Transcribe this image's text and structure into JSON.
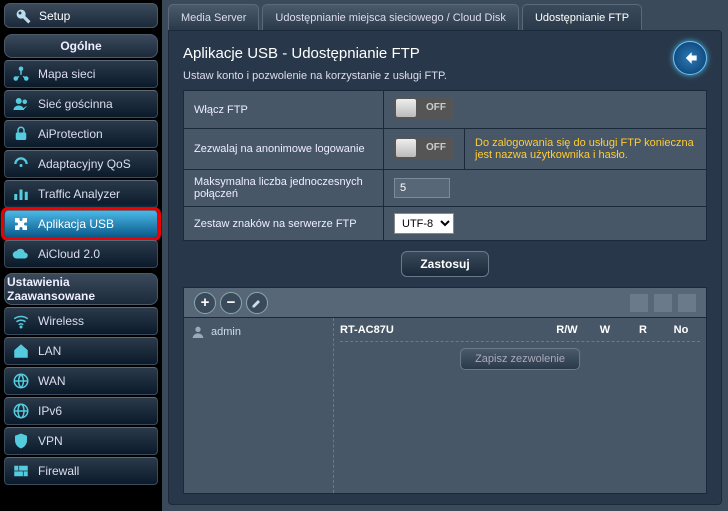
{
  "sidebar": {
    "setup": "Setup",
    "general_header": "Ogólne",
    "advanced_header": "Ustawienia Zaawansowane",
    "general": [
      {
        "id": "map",
        "label": "Mapa sieci"
      },
      {
        "id": "guest",
        "label": "Sieć gościnna"
      },
      {
        "id": "aiprotect",
        "label": "AiProtection"
      },
      {
        "id": "qos",
        "label": "Adaptacyjny QoS"
      },
      {
        "id": "traffic",
        "label": "Traffic Analyzer"
      },
      {
        "id": "usb",
        "label": "Aplikacja USB"
      },
      {
        "id": "aicloud",
        "label": "AiCloud 2.0"
      }
    ],
    "advanced": [
      {
        "id": "wireless",
        "label": "Wireless"
      },
      {
        "id": "lan",
        "label": "LAN"
      },
      {
        "id": "wan",
        "label": "WAN"
      },
      {
        "id": "ipv6",
        "label": "IPv6"
      },
      {
        "id": "vpn",
        "label": "VPN"
      },
      {
        "id": "firewall",
        "label": "Firewall"
      }
    ]
  },
  "tabs": [
    {
      "id": "media",
      "label": "Media Server"
    },
    {
      "id": "cloud",
      "label": "Udostępnianie miejsca sieciowego / Cloud Disk"
    },
    {
      "id": "ftp",
      "label": "Udostępnianie FTP"
    }
  ],
  "page": {
    "title": "Aplikacje USB - Udostępnianie FTP",
    "desc": "Ustaw konto i pozwolenie na korzystanie z usługi FTP."
  },
  "form": {
    "enable_ftp_label": "Włącz FTP",
    "enable_ftp_value": "OFF",
    "anon_label": "Zezwalaj na anonimowe logowanie",
    "anon_value": "OFF",
    "anon_note": "Do zalogowania się do usługi FTP konieczna jest nazwa użytkownika i hasło.",
    "max_conn_label": "Maksymalna liczba jednoczesnych połączeń",
    "max_conn_value": "5",
    "charset_label": "Zestaw znaków na serwerze FTP",
    "charset_value": "UTF-8",
    "apply": "Zastosuj"
  },
  "share": {
    "user": "admin",
    "device": "RT-AC87U",
    "cols": [
      "R/W",
      "W",
      "R",
      "No"
    ],
    "save_btn": "Zapisz zezwolenie"
  }
}
